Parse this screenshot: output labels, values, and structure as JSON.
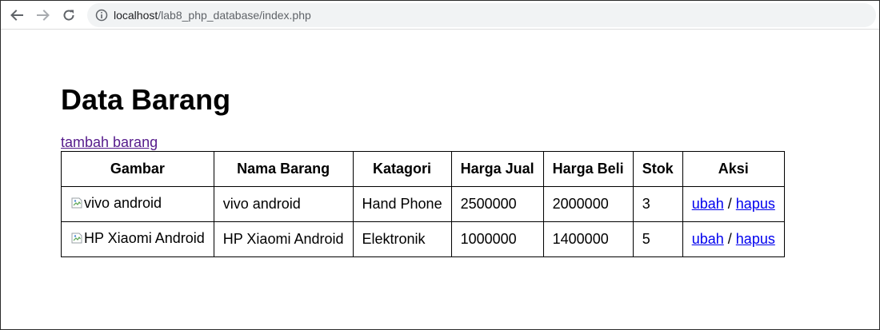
{
  "browser": {
    "url_host": "localhost",
    "url_path": "/lab8_php_database/index.php"
  },
  "page": {
    "title": "Data Barang",
    "add_link": "tambah barang"
  },
  "table": {
    "headers": [
      "Gambar",
      "Nama Barang",
      "Katagori",
      "Harga Jual",
      "Harga Beli",
      "Stok",
      "Aksi"
    ],
    "rows": [
      {
        "gambar_alt": "vivo android",
        "nama": "vivo android",
        "katagori": "Hand Phone",
        "harga_jual": "2500000",
        "harga_beli": "2000000",
        "stok": "3",
        "ubah": "ubah",
        "sep": "/",
        "hapus": "hapus"
      },
      {
        "gambar_alt": "HP Xiaomi Android",
        "nama": "HP Xiaomi Android",
        "katagori": "Elektronik",
        "harga_jual": "1000000",
        "harga_beli": "1400000",
        "stok": "5",
        "ubah": "ubah",
        "sep": "/",
        "hapus": "hapus"
      }
    ]
  },
  "icons": {
    "back": "back-arrow-icon",
    "forward": "forward-arrow-icon",
    "reload": "reload-icon",
    "info": "info-icon",
    "broken_image": "broken-image-icon"
  },
  "colors": {
    "visited_link": "#551a8b",
    "link": "#0000ee",
    "omnibox_bg": "#f1f3f4"
  }
}
